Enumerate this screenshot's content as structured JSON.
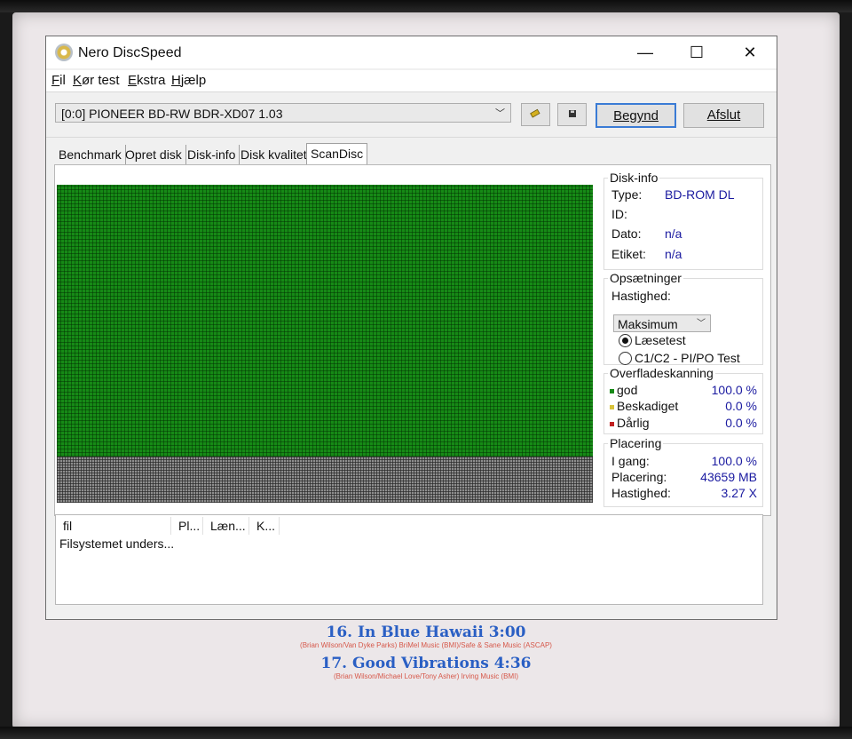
{
  "window": {
    "title": "Nero DiscSpeed",
    "minimize_glyph": "—",
    "maximize_glyph": "☐",
    "close_glyph": "✕"
  },
  "menu": [
    {
      "label": "Fil",
      "mnemonic": "F"
    },
    {
      "label": "Kør test",
      "mnemonic": "K"
    },
    {
      "label": "Ekstra",
      "mnemonic": "E"
    },
    {
      "label": "Hjælp",
      "mnemonic": "H"
    }
  ],
  "menu_labels": {
    "fil_rest": "il",
    "kor_rest": "ør test",
    "ekstra_rest": "kstra",
    "hjaelp_rest": "jælp",
    "fil_first": "F",
    "kor_first": "K",
    "ekstra_first": "E",
    "hjaelp_first": "H"
  },
  "toolbar": {
    "drive": "[0:0]   PIONEER BD-RW   BDR-XD07 1.03",
    "start_label": "Begynd",
    "exit_label": "Afslut",
    "icons": [
      "drive-info-icon",
      "save-icon"
    ]
  },
  "tabs": [
    "Benchmark",
    "Opret disk",
    "Disk-info",
    "Disk kvalitet",
    "ScanDisc"
  ],
  "active_tab": "ScanDisc",
  "disk_info": {
    "title": "Disk-info",
    "type_label": "Type:",
    "type_value": "BD-ROM DL",
    "id_label": "ID:",
    "id_value": "",
    "date_label": "Dato:",
    "date_value": "n/a",
    "label_label": "Etiket:",
    "label_value": "n/a"
  },
  "settings": {
    "title": "Opsætninger",
    "speed_label": "Hastighed:",
    "speed_value": "Maksimum",
    "radio_read": "Læsetest",
    "radio_c1c2": "C1/C2 - PI/PO Test",
    "selected": "Læsetest"
  },
  "surface": {
    "title": "Overfladeskanning",
    "good_label": "god",
    "good_value": "100.0 %",
    "good_color": "#168a16",
    "damaged_label": "Beskadiget",
    "damaged_value": "0.0 %",
    "damaged_color": "#d8c23a",
    "bad_label": "Dårlig",
    "bad_value": "0.0 %",
    "bad_color": "#c02020",
    "good_fraction": 0.854
  },
  "position": {
    "title": "Placering",
    "progress_label": "I gang:",
    "progress_value": "100.0 %",
    "location_label": "Placering:",
    "location_value": "43659 MB",
    "speed_label": "Hastighed:",
    "speed_value": "3.27 X"
  },
  "filelist": {
    "columns": [
      "fil",
      "Pl...",
      "Læn...",
      "K..."
    ],
    "status": "Filsystemet unders..."
  },
  "background_liner": {
    "track16_title": "16. In Blue Hawaii 3:00",
    "track16_credit": "(Brian Wilson/Van Dyke Parks) BriMel Music (BMI)/Safe & Sane Music (ASCAP)",
    "track17_title": "17. Good Vibrations 4:36",
    "track17_credit": "(Brian Wilson/Michael Love/Tony Asher) Irving Music (BMI)"
  }
}
